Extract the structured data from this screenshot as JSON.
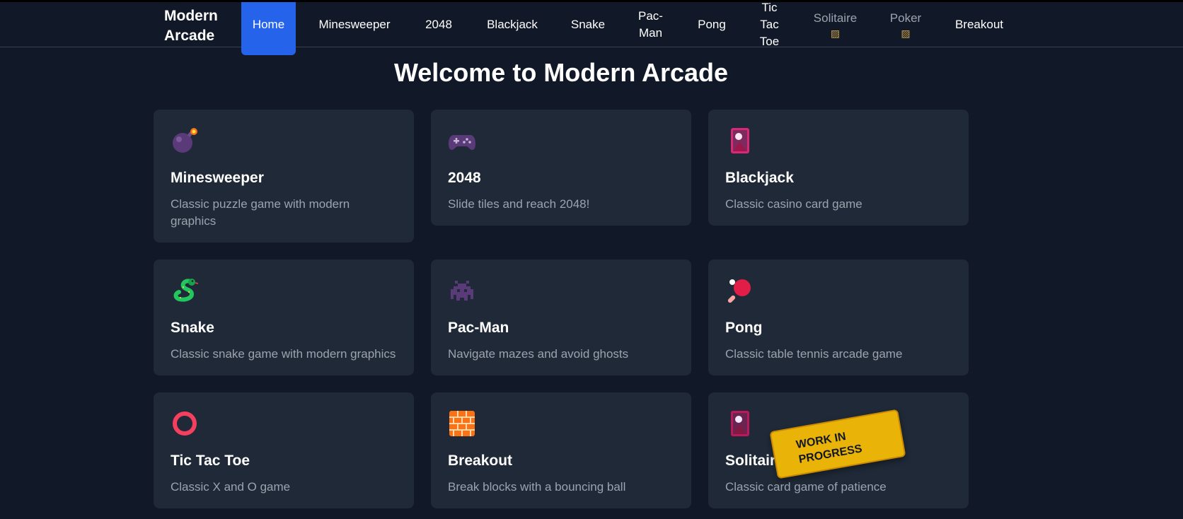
{
  "brand": "Modern Arcade",
  "nav": [
    {
      "label": "Home",
      "active": true
    },
    {
      "label": "Minesweeper"
    },
    {
      "label": "2048"
    },
    {
      "label": "Blackjack"
    },
    {
      "label": "Snake"
    },
    {
      "label": "Pac-Man"
    },
    {
      "label": "Pong"
    },
    {
      "label": "Tic Tac Toe"
    },
    {
      "label": "Solitaire",
      "disabled": true,
      "icon": "construction-icon"
    },
    {
      "label": "Poker",
      "disabled": true,
      "icon": "construction-icon"
    },
    {
      "label": "Breakout"
    }
  ],
  "title": "Welcome to Modern Arcade",
  "cards": [
    {
      "title": "Minesweeper",
      "desc": "Classic puzzle game with modern graphics",
      "icon": "bomb-icon"
    },
    {
      "title": "2048",
      "desc": "Slide tiles and reach 2048!",
      "icon": "game-controller-icon"
    },
    {
      "title": "Blackjack",
      "desc": "Classic casino card game",
      "icon": "playing-card-icon"
    },
    {
      "title": "Snake",
      "desc": "Classic snake game with modern graphics",
      "icon": "snake-icon"
    },
    {
      "title": "Pac-Man",
      "desc": "Navigate mazes and avoid ghosts",
      "icon": "space-invader-icon"
    },
    {
      "title": "Pong",
      "desc": "Classic table tennis arcade game",
      "icon": "ping-pong-icon"
    },
    {
      "title": "Tic Tac Toe",
      "desc": "Classic X and O game",
      "icon": "circle-icon"
    },
    {
      "title": "Breakout",
      "desc": "Break blocks with a bouncing ball",
      "icon": "brick-icon"
    },
    {
      "title": "Solitaire",
      "desc": "Classic card game of patience",
      "icon": "playing-card-icon"
    }
  ],
  "wip_badge": "WORK IN PROGRESS",
  "colors": {
    "background": "#111827",
    "card": "#1f2937",
    "accent": "#2563eb",
    "badge": "#eab308",
    "muted": "#9ca3af"
  }
}
